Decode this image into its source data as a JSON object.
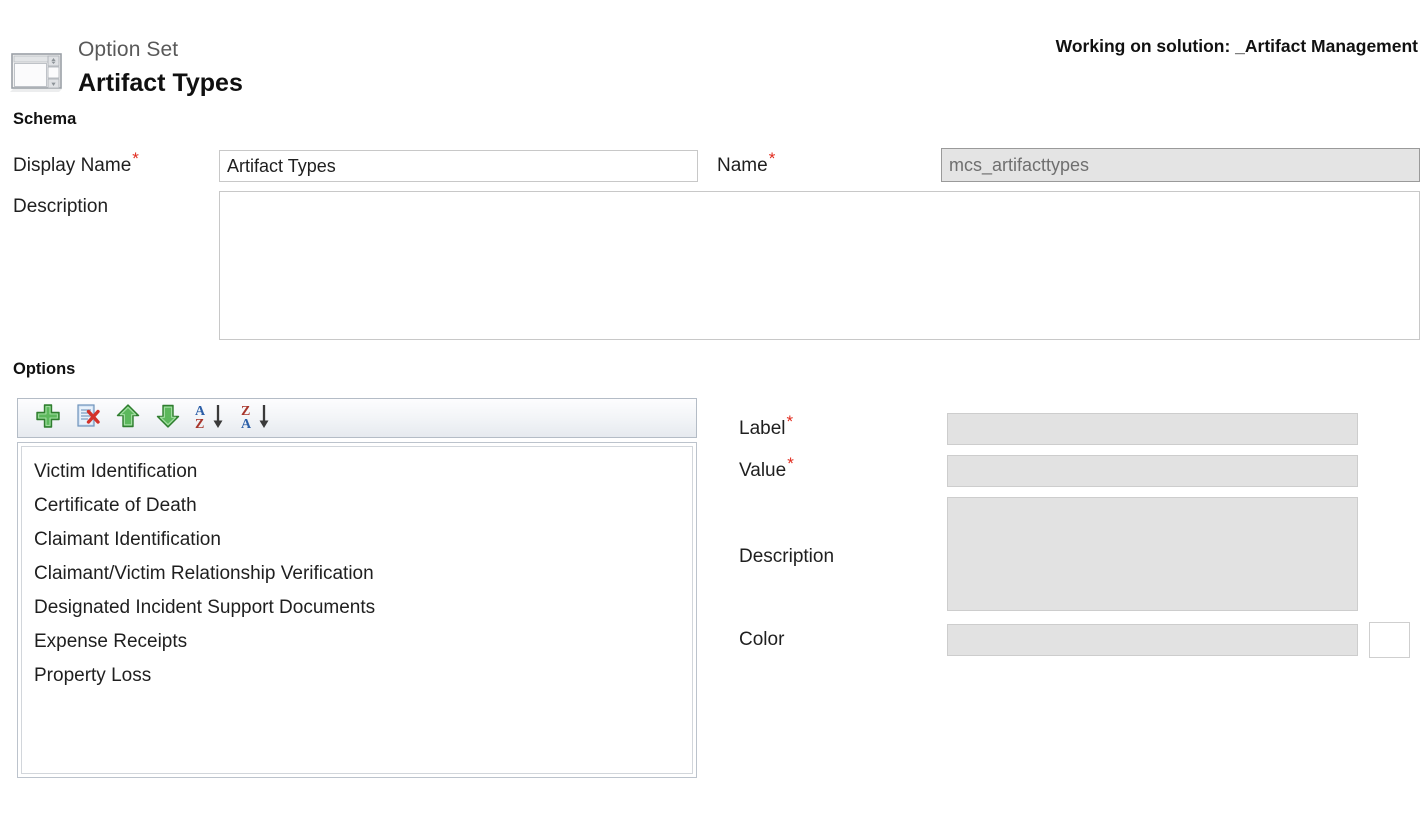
{
  "header": {
    "icon": "option-set-icon",
    "kind": "Option Set",
    "title": "Artifact Types",
    "solution_banner": "Working on solution: _Artifact Management"
  },
  "schema": {
    "heading": "Schema",
    "display_name": {
      "label": "Display Name",
      "required_mark": "*",
      "value": "Artifact Types",
      "placeholder": ""
    },
    "name": {
      "label": "Name",
      "required_mark": "*",
      "value": "mcs_artifacttypes",
      "placeholder": "",
      "readonly": true
    },
    "description": {
      "label": "Description",
      "value": "",
      "placeholder": ""
    }
  },
  "options": {
    "heading": "Options",
    "toolbar": [
      {
        "name": "add-option-button",
        "label": "New",
        "icon": "green-plus-icon"
      },
      {
        "name": "delete-option-button",
        "label": "Delete",
        "icon": "document-delete-icon"
      },
      {
        "name": "move-up-button",
        "label": "Move Up",
        "icon": "green-up-arrow-icon"
      },
      {
        "name": "move-down-button",
        "label": "Move Down",
        "icon": "green-down-arrow-icon"
      },
      {
        "name": "sort-ascending-button",
        "label": "Sort Ascending",
        "icon": "sort-az-icon"
      },
      {
        "name": "sort-descending-button",
        "label": "Sort Descending",
        "icon": "sort-za-icon"
      }
    ],
    "items": [
      "Victim Identification",
      "Certificate of Death",
      "Claimant Identification",
      "Claimant/Victim Relationship Verification",
      "Designated Incident Support Documents",
      "Expense Receipts",
      "Property Loss"
    ]
  },
  "detail": {
    "label_field": {
      "label": "Label",
      "required_mark": "*",
      "value": "",
      "placeholder": "",
      "disabled": true
    },
    "value_field": {
      "label": "Value",
      "required_mark": "*",
      "value": "",
      "placeholder": "",
      "disabled": true
    },
    "description_field": {
      "label": "Description",
      "value": "",
      "placeholder": "",
      "disabled": true
    },
    "color_field": {
      "label": "Color",
      "value": "",
      "placeholder": "",
      "disabled": true,
      "swatch_color": "#ffffff"
    }
  },
  "colors": {
    "required_asterisk": "#e1291c",
    "disabled_field_bg": "#e2e2e2",
    "readonly_field_bg": "#e4e4e4",
    "page_bg": "#ffffff",
    "text": "#1f1f1f"
  }
}
